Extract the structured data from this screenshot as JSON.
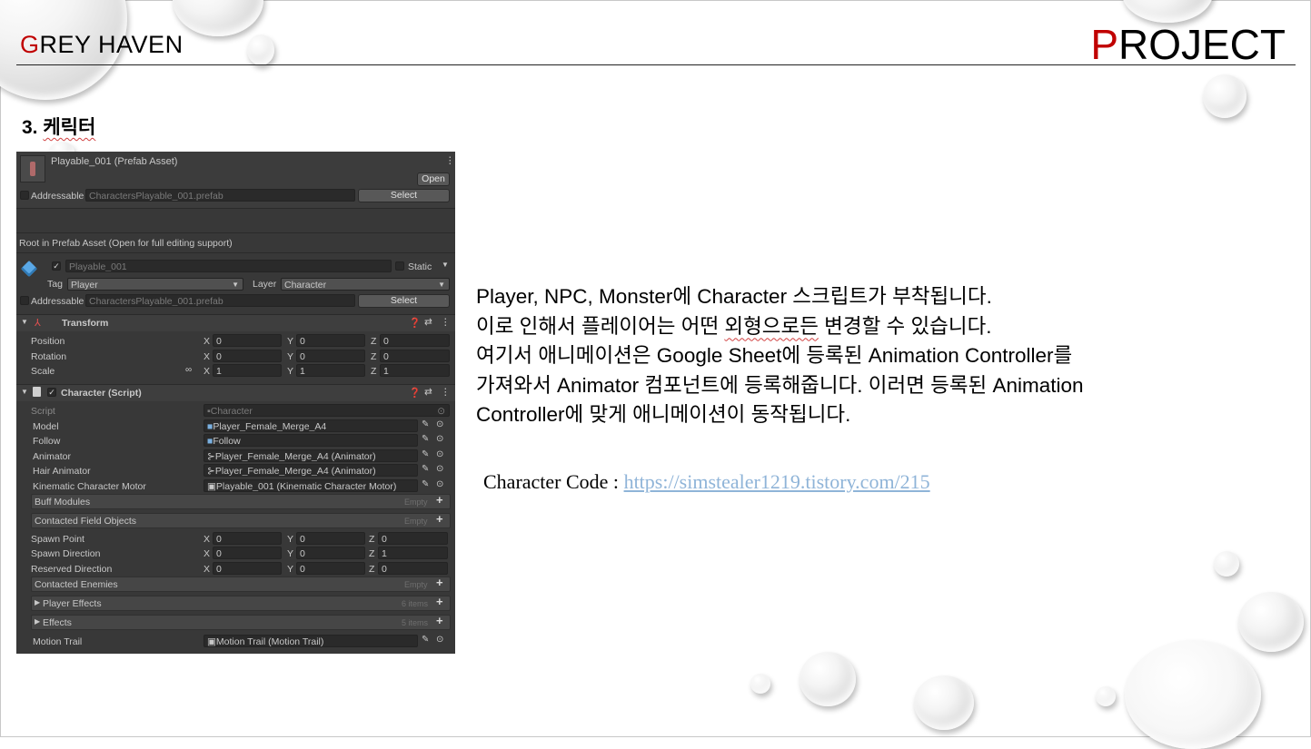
{
  "slide": {
    "brand_first": "G",
    "brand_rest": "REY HAVEN",
    "project_first": "P",
    "project_rest": "ROJECT",
    "section_number": "3.",
    "section_title": "케릭터",
    "accent_color": "#c00000"
  },
  "inspector": {
    "asset_title": "Playable_001 (Prefab Asset)",
    "open_label": "Open",
    "addressable_label": "Addressable",
    "addressable_path": "CharactersPlayable_001.prefab",
    "select_label": "Select",
    "root_note": "Root in Prefab Asset (Open for full editing support)",
    "object_name": "Playable_001",
    "static_label": "Static",
    "tag_label": "Tag",
    "tag_value": "Player",
    "layer_label": "Layer",
    "layer_value": "Character",
    "addressable_label2": "Addressable",
    "addressable_path2": "CharactersPlayable_001.prefab",
    "select_label2": "Select",
    "transform": {
      "title": "Transform",
      "rows": [
        {
          "label": "Position",
          "x": "0",
          "y": "0",
          "z": "0"
        },
        {
          "label": "Rotation",
          "x": "0",
          "y": "0",
          "z": "0"
        },
        {
          "label": "Scale",
          "x": "1",
          "y": "1",
          "z": "1"
        }
      ]
    },
    "character": {
      "title": "Character (Script)",
      "script_label": "Script",
      "script_value": "Character",
      "refs": [
        {
          "label": "Model",
          "value": "Player_Female_Merge_A4",
          "icon": "■"
        },
        {
          "label": "Follow",
          "value": "Follow",
          "icon": "■"
        },
        {
          "label": "Animator",
          "value": "Player_Female_Merge_A4 (Animator)",
          "icon": "⊱"
        },
        {
          "label": "Hair Animator",
          "value": "Player_Female_Merge_A4 (Animator)",
          "icon": "⊱"
        },
        {
          "label": "Kinematic Character Motor",
          "value": "Playable_001 (Kinematic Character Motor)",
          "icon": "▣"
        }
      ],
      "buff_modules": "Buff Modules",
      "contacted_field_objects": "Contacted Field Objects",
      "empty": "Empty",
      "vectors": [
        {
          "label": "Spawn Point",
          "x": "0",
          "y": "0",
          "z": "0"
        },
        {
          "label": "Spawn Direction",
          "x": "0",
          "y": "0",
          "z": "1"
        },
        {
          "label": "Reserved Direction",
          "x": "0",
          "y": "0",
          "z": "0"
        }
      ],
      "contacted_enemies": "Contacted Enemies",
      "player_effects": "Player Effects",
      "player_effects_count": "6 items",
      "effects": "Effects",
      "effects_count": "5 items",
      "motion_trail_label": "Motion Trail",
      "motion_trail_value": "Motion Trail (Motion Trail)"
    }
  },
  "description": {
    "line1": "Player, NPC, Monster에 Character 스크립트가 부착됩니다.",
    "line2a": "이로 인해서 플레이어는 어떤 ",
    "line2b": "외형으로든",
    "line2c": " 변경할 수 있습니다.",
    "line3": "여기서 애니메이션은 Google Sheet에 등록된 Animation Controller를",
    "line4": "가져와서 Animator 컴포넌트에 등록해줍니다. 이러면 등록된 Animation",
    "line5": "Controller에 맞게 애니메이션이 동작됩니다."
  },
  "code": {
    "label": "Character Code : ",
    "url": "https://simstealer1219.tistory.com/215",
    "link_color": "#8fb4d8"
  }
}
